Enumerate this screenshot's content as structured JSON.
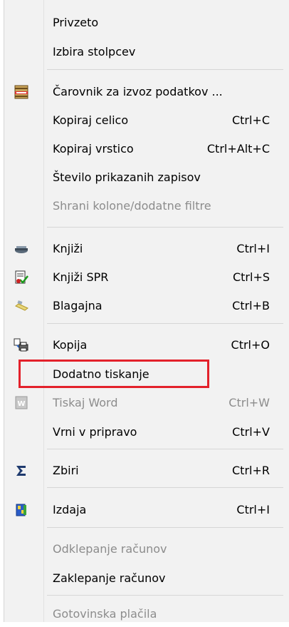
{
  "menu": {
    "items": [
      {
        "label": "Privzeto",
        "shortcut": "",
        "icon": "",
        "disabled": false
      },
      {
        "label": "Izbira stolpcev",
        "shortcut": "",
        "icon": "",
        "disabled": false
      },
      {
        "label": "Čarovnik za izvoz podatkov ...",
        "shortcut": "",
        "icon": "export-wizard-icon",
        "disabled": false
      },
      {
        "label": "Kopiraj celico",
        "shortcut": "Ctrl+C",
        "icon": "",
        "disabled": false
      },
      {
        "label": "Kopiraj vrstico",
        "shortcut": "Ctrl+Alt+C",
        "icon": "",
        "disabled": false
      },
      {
        "label": "Število prikazanih zapisov",
        "shortcut": "",
        "icon": "",
        "disabled": false
      },
      {
        "label": "Shrani kolone/dodatne filtre",
        "shortcut": "",
        "icon": "",
        "disabled": true
      },
      {
        "label": "Knjiži",
        "shortcut": "Ctrl+I",
        "icon": "post-icon",
        "disabled": false
      },
      {
        "label": "Knjiži SPR",
        "shortcut": "Ctrl+S",
        "icon": "post-spr-icon",
        "disabled": false
      },
      {
        "label": "Blagajna",
        "shortcut": "Ctrl+B",
        "icon": "cash-register-icon",
        "disabled": false
      },
      {
        "label": "Kopija",
        "shortcut": "Ctrl+O",
        "icon": "copy-print-icon",
        "disabled": false
      },
      {
        "label": "Dodatno tiskanje",
        "shortcut": "",
        "icon": "",
        "disabled": false
      },
      {
        "label": "Tiskaj Word",
        "shortcut": "Ctrl+W",
        "icon": "word-icon",
        "disabled": true
      },
      {
        "label": "Vrni v pripravo",
        "shortcut": "Ctrl+V",
        "icon": "",
        "disabled": false
      },
      {
        "label": "Zbiri",
        "shortcut": "Ctrl+R",
        "icon": "sigma-icon",
        "disabled": false
      },
      {
        "label": "Izdaja",
        "shortcut": "Ctrl+I",
        "icon": "issue-icon",
        "disabled": false
      },
      {
        "label": "Odklepanje računov",
        "shortcut": "",
        "icon": "",
        "disabled": true
      },
      {
        "label": "Zaklepanje računov",
        "shortcut": "",
        "icon": "",
        "disabled": false
      },
      {
        "label": "Gotovinska plačila",
        "shortcut": "",
        "icon": "",
        "disabled": true
      }
    ],
    "highlighted_item": "Dodatno tiskanje",
    "highlight_color": "#e3212b"
  }
}
